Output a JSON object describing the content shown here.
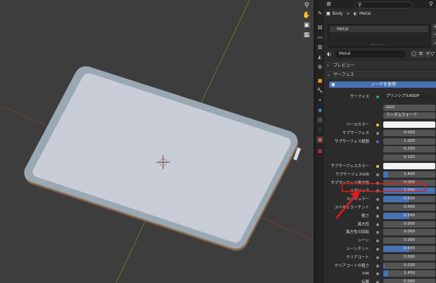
{
  "viewport": {
    "tools": [
      "zoom-icon",
      "hand-icon",
      "camera-icon",
      "grid-icon"
    ]
  },
  "properties": {
    "search_placeholder": "",
    "breadcrumb": {
      "object": "Body",
      "separator": ">",
      "material": "Metal"
    },
    "material_slot": "Metal",
    "material_name": "Metal",
    "sections": {
      "preview": "プレビュー",
      "surface": "サーフェス"
    },
    "use_nodes_button": "ノードを使用",
    "surface_label": "サーフェス",
    "surface_shader": "プリンシプルBSDF",
    "distribution": "GGX",
    "subsurface_method": "ランダムウォーク",
    "rows": [
      {
        "label": "ベースカラー",
        "value": "",
        "kind": "color"
      },
      {
        "label": "サブサーフェス",
        "value": "0.000",
        "kind": "num",
        "fill": 0
      },
      {
        "label": "サブサーフェス範囲",
        "value": "1.000",
        "kind": "num",
        "fill": 0
      },
      {
        "label": "",
        "value": "0.200",
        "kind": "num",
        "fill": 0
      },
      {
        "label": "",
        "value": "0.100",
        "kind": "num",
        "fill": 0
      },
      {
        "label": "サブサーフェスカラー",
        "value": "",
        "kind": "color"
      },
      {
        "label": "サブサーフェスIOR",
        "value": "1.400",
        "kind": "num",
        "fill": 0.1
      },
      {
        "label": "サブサーフェス異方性",
        "value": "0.000",
        "kind": "num",
        "fill": 0
      },
      {
        "label": "メタリック",
        "value": "1.000",
        "kind": "num",
        "fill": 1.0
      },
      {
        "label": "スペキュラー",
        "value": "0.500",
        "kind": "num",
        "fill": 0.5
      },
      {
        "label": "スペキュラーチント",
        "value": "0.000",
        "kind": "num",
        "fill": 0
      },
      {
        "label": "粗さ",
        "value": "0.500",
        "kind": "num",
        "fill": 0.5
      },
      {
        "label": "異方性",
        "value": "0.000",
        "kind": "num",
        "fill": 0
      },
      {
        "label": "異方性の回転",
        "value": "0.000",
        "kind": "num",
        "fill": 0
      },
      {
        "label": "シーン",
        "value": "0.000",
        "kind": "num",
        "fill": 0
      },
      {
        "label": "シーンチント",
        "value": "0.500",
        "kind": "num",
        "fill": 0.5
      },
      {
        "label": "クリアコート",
        "value": "0.000",
        "kind": "num",
        "fill": 0
      },
      {
        "label": "クリアコートの粗さ",
        "value": "0.030",
        "kind": "num",
        "fill": 0.03
      },
      {
        "label": "IOR",
        "value": "1.450",
        "kind": "num",
        "fill": 0.1
      },
      {
        "label": "伝搬",
        "value": "0.000",
        "kind": "num",
        "fill": 0
      }
    ]
  },
  "colors": {
    "accent": "#4772b3",
    "highlight": "#e21b1b",
    "tablet_body": "#c9cdd8",
    "tablet_frame": "#9aa8b3"
  }
}
